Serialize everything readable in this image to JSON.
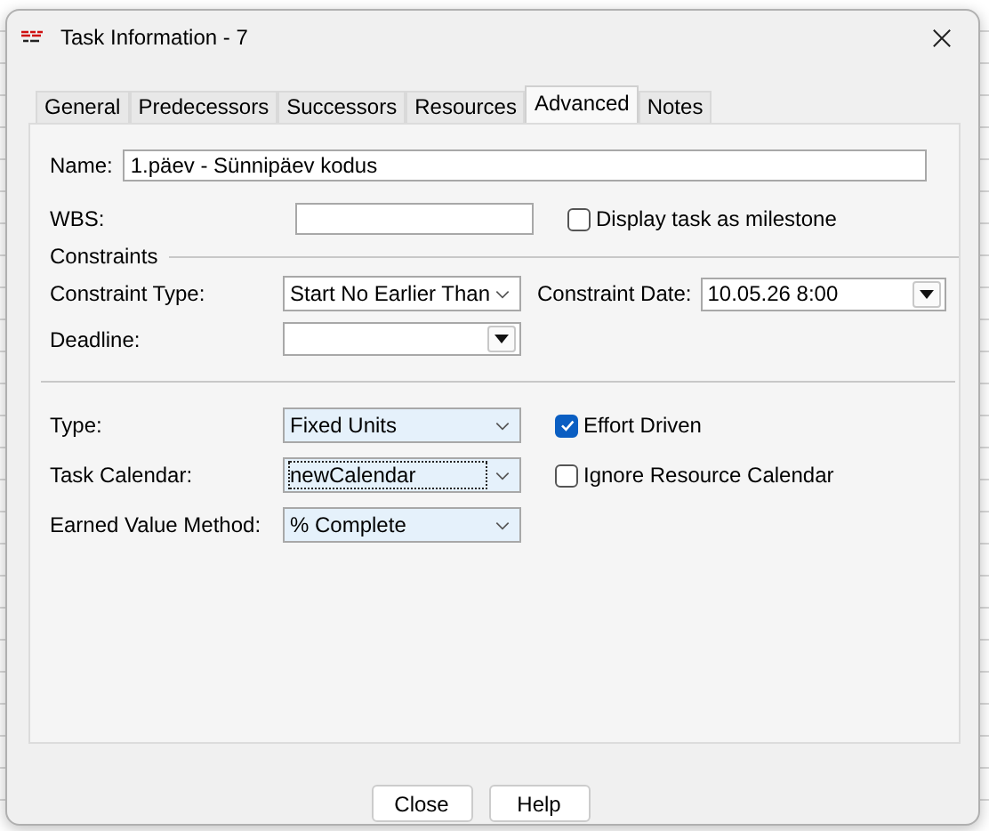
{
  "window": {
    "title": "Task Information - 7"
  },
  "tabs": [
    {
      "label": "General",
      "selected": false
    },
    {
      "label": "Predecessors",
      "selected": false
    },
    {
      "label": "Successors",
      "selected": false
    },
    {
      "label": "Resources",
      "selected": false
    },
    {
      "label": "Advanced",
      "selected": true
    },
    {
      "label": "Notes",
      "selected": false
    }
  ],
  "name_field": {
    "label": "Name:",
    "value": "1.päev - Sünnipäev kodus"
  },
  "wbs_field": {
    "label": "WBS:"
  },
  "milestone_checkbox": {
    "label": "Display task as milestone",
    "checked": false
  },
  "constraints": {
    "heading": "Constraints",
    "fields": [
      {
        "label": "Constraint Type:",
        "value": "Start No Earlier Than",
        "kind": "combo",
        "highlighted": false
      },
      {
        "label": "Constraint Date:",
        "value": "10.05.26 8:00",
        "kind": "date"
      },
      {
        "label": "Deadline:",
        "kind": "date"
      }
    ]
  },
  "task_settings": [
    {
      "label": "Type:",
      "value": "Fixed Units",
      "kind": "combo",
      "highlighted": true,
      "focused": false
    },
    {
      "label": "Task Calendar:",
      "value": "newCalendar",
      "kind": "combo",
      "highlighted": true,
      "focused": true
    },
    {
      "label": "Earned Value Method:",
      "value": "% Complete",
      "kind": "combo",
      "highlighted": true,
      "focused": false
    }
  ],
  "checkboxes": [
    {
      "label": "Effort Driven",
      "checked": true
    },
    {
      "label": "Ignore Resource Calendar",
      "checked": false
    }
  ],
  "buttons": [
    "Close",
    "Help"
  ]
}
